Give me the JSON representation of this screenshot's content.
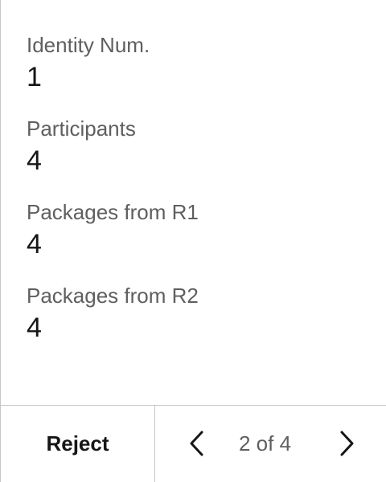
{
  "details": {
    "fields": [
      {
        "label": "Identity Num.",
        "value": "1"
      },
      {
        "label": "Participants",
        "value": "4"
      },
      {
        "label": "Packages from R1",
        "value": "4"
      },
      {
        "label": "Packages from R2",
        "value": "4"
      }
    ]
  },
  "footer": {
    "reject_label": "Reject",
    "pager": {
      "text": "2 of 4",
      "prev_icon": "chevron-left-icon",
      "next_icon": "chevron-right-icon"
    }
  },
  "colors": {
    "border": "#c6c6c6",
    "label_text": "#5f5f5f",
    "value_text": "#161616"
  }
}
